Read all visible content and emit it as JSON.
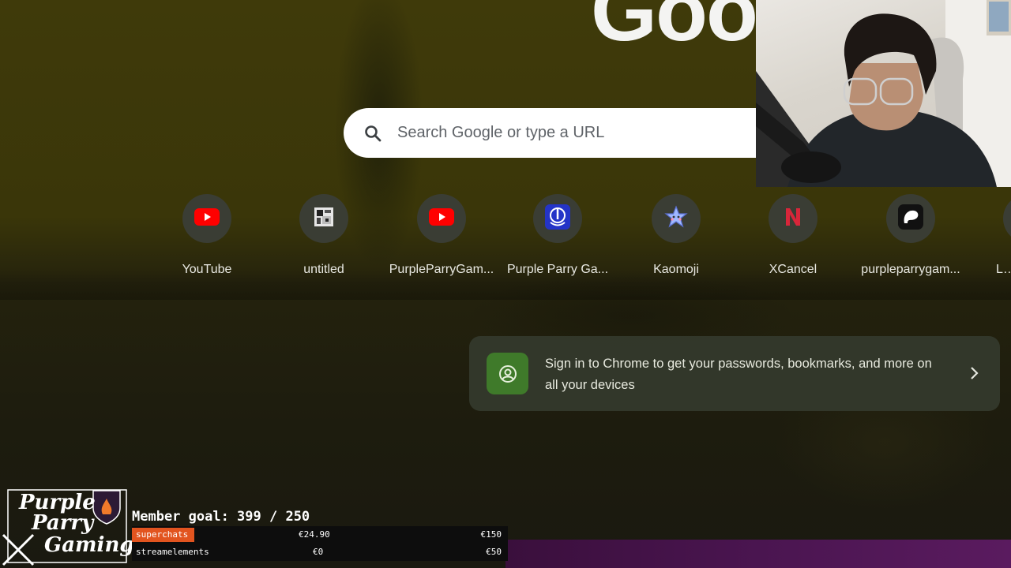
{
  "google_logo": "Goo",
  "search": {
    "placeholder": "Search Google or type a URL"
  },
  "shortcuts": [
    {
      "label": "YouTube",
      "icon": "youtube-icon"
    },
    {
      "label": "untitled",
      "icon": "favicon-icon"
    },
    {
      "label": "PurpleParryGam...",
      "icon": "youtube-icon"
    },
    {
      "label": "Purple Parry Ga...",
      "icon": "shield-icon"
    },
    {
      "label": "Kaomoji",
      "icon": "star-icon"
    },
    {
      "label": "XCancel",
      "icon": "n-letter-icon"
    },
    {
      "label": "purpleparrygam...",
      "icon": "blob-icon"
    },
    {
      "label": "LiamD",
      "icon": "favicon-icon"
    }
  ],
  "signin_card": {
    "text": "Sign in to Chrome to get your passwords, bookmarks, and more on all your devices"
  },
  "stream_overlay": {
    "logo_lines": [
      "Purple",
      "Parry",
      "Gaming"
    ],
    "member_goal": "Member goal: 399 / 250",
    "rows": [
      {
        "name": "superchats",
        "current": "€24.90",
        "target": "€150",
        "progress": 0.166
      },
      {
        "name": "streamelements",
        "current": "€0",
        "target": "€50",
        "progress": 0
      }
    ]
  },
  "colors": {
    "youtube_red": "#ff0000",
    "signin_green": "#3f7a2a",
    "progress_orange": "#e2541f"
  }
}
